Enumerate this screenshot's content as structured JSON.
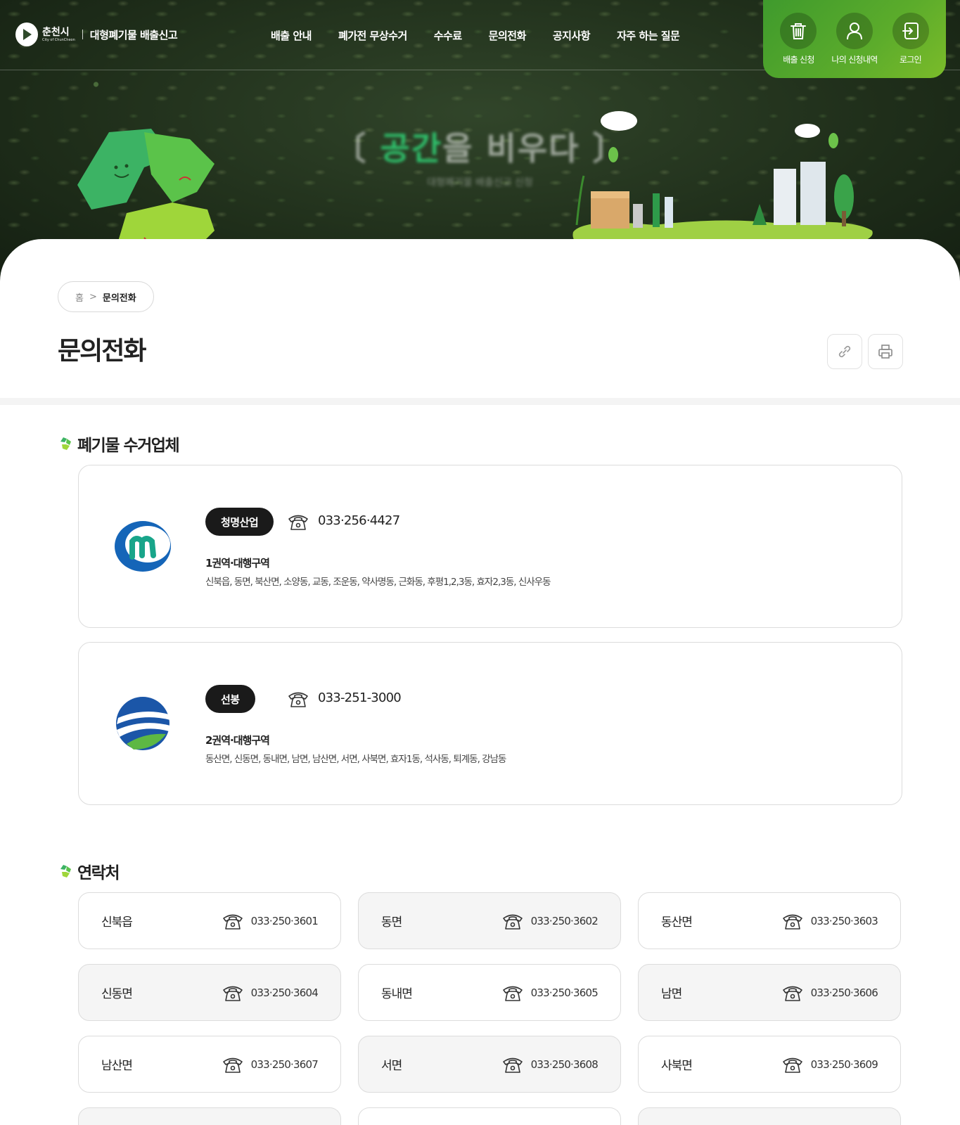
{
  "header": {
    "logo_city": "춘천시",
    "logo_city_en": "City of ChunCheon",
    "service_name": "대형폐기물 배출신고",
    "nav": [
      "배출 안내",
      "폐가전 무상수거",
      "수수료",
      "문의전화",
      "공지사항",
      "자주 하는 질문"
    ],
    "quick": [
      {
        "label": "배출 신청",
        "icon": "trash-icon"
      },
      {
        "label": "나의 신청내역",
        "icon": "user-icon"
      },
      {
        "label": "로그인",
        "icon": "login-icon"
      }
    ],
    "accent_color": "#5cac2b"
  },
  "hero": {
    "headline_green": "공간",
    "headline_rest": "을 비우다",
    "subline": "대형폐기물 배출신고 신청"
  },
  "breadcrumb": {
    "home": "홈",
    "separator": ">",
    "current": "문의전화"
  },
  "page_title": "문의전화",
  "sections": {
    "companies_title": "폐기물 수거업체",
    "contacts_title": "연락처"
  },
  "companies": [
    {
      "name": "청명산업",
      "phone": "033·256·4427",
      "area_title": "1권역·대행구역",
      "areas": "신북읍, 동면, 북산면, 소양동, 교동, 조운동, 약사명동, 근화동, 후평1,2,3동, 효자2,3동, 신사우동"
    },
    {
      "name": "선봉",
      "phone": "033-251-3000",
      "area_title": "2권역·대행구역",
      "areas": "동산면, 신동면, 동내면, 남면, 남산면, 서면, 사북면, 효자1동, 석사동, 퇴계동, 강남동"
    }
  ],
  "contacts": [
    {
      "name": "신북읍",
      "phone": "033·250·3601"
    },
    {
      "name": "동면",
      "phone": "033·250·3602"
    },
    {
      "name": "동산면",
      "phone": "033·250·3603"
    },
    {
      "name": "신동면",
      "phone": "033·250·3604"
    },
    {
      "name": "동내면",
      "phone": "033·250·3605"
    },
    {
      "name": "남면",
      "phone": "033·250·3606"
    },
    {
      "name": "남산면",
      "phone": "033·250·3607"
    },
    {
      "name": "서면",
      "phone": "033·250·3608"
    },
    {
      "name": "사북면",
      "phone": "033·250·3609"
    }
  ]
}
